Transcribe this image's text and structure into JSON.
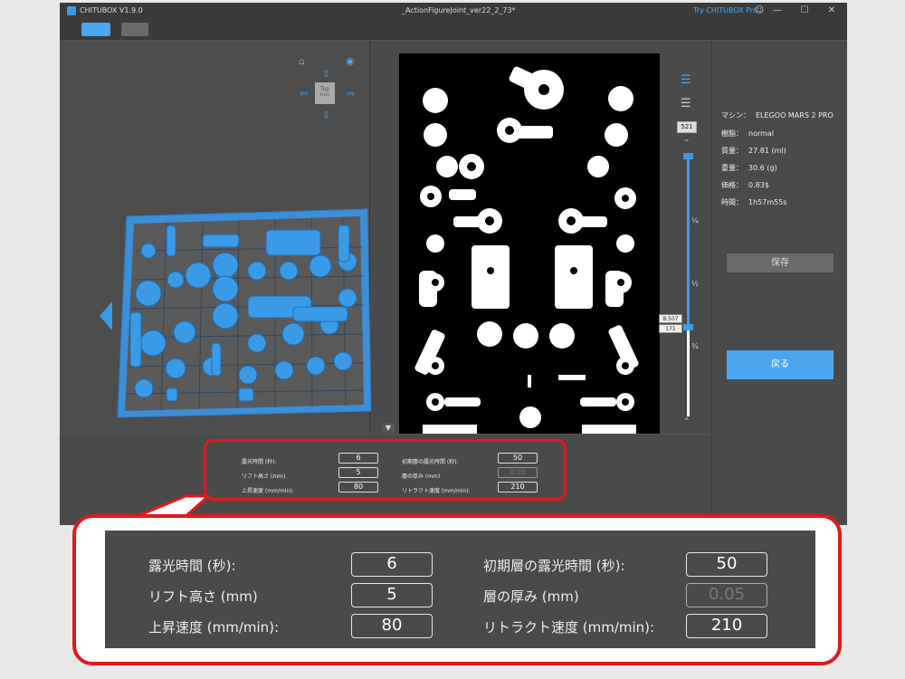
{
  "window": {
    "app_title": "CHITUBOX V1.9.0",
    "document_title": "_ActionFigureJoint_ver22_2_73*",
    "pro_link": "Try CHITUBOX Pro"
  },
  "viewport": {
    "nav_cube_top": "Top",
    "nav_cube_front": "Front"
  },
  "layers": {
    "current_layer": "521",
    "slider_value_top": "8.507",
    "slider_value_bottom": "171",
    "fractions": [
      "¼",
      "½",
      "¾"
    ]
  },
  "info": {
    "rows": [
      {
        "key": "マシン：",
        "value": "ELEGOO MARS 2 PRO"
      },
      {
        "key": "樹脂：",
        "value": "normal"
      },
      {
        "key": "質量：",
        "value": "27.81  (ml)"
      },
      {
        "key": "重量：",
        "value": "30.6  (g)"
      },
      {
        "key": "価格：",
        "value": "0.83$"
      },
      {
        "key": "時間：",
        "value": "1h57m55s"
      }
    ],
    "save_label": "保存",
    "back_label": "戻る"
  },
  "settings": {
    "exposure_time": {
      "label": "露光時間 (秒):",
      "value": "6"
    },
    "lift_height": {
      "label": "リフト高さ (mm)",
      "value": "5"
    },
    "lift_speed": {
      "label": "上昇速度 (mm/min):",
      "value": "80"
    },
    "bottom_exposure": {
      "label": "初期層の露光時間 (秒):",
      "value": "50"
    },
    "layer_height": {
      "label": "層の厚み (mm)",
      "value": "0.05"
    },
    "retract_speed": {
      "label": "リトラクト速度 (mm/min):",
      "value": "210"
    }
  },
  "colors": {
    "accent": "#3b9be8",
    "callout": "#e0191c",
    "panel": "#4a4a4a"
  }
}
